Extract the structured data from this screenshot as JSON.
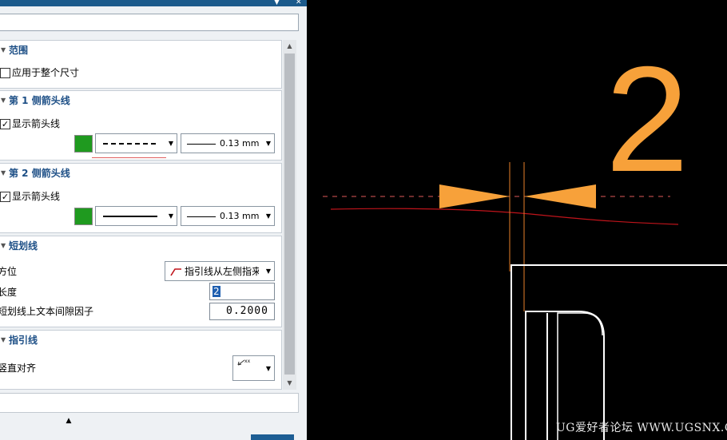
{
  "panel": {
    "groups": {
      "range": {
        "title": "范围",
        "apply_whole_label": "应用于整个尺寸",
        "apply_whole_checked": false
      },
      "arrow1": {
        "title": "第 1 侧箭头线",
        "show_label": "显示箭头线",
        "show_checked": true,
        "color": "#1f9a1f",
        "line_style": "dashed",
        "width_value": "0.13 mm"
      },
      "arrow2": {
        "title": "第 2 侧箭头线",
        "show_label": "显示箭头线",
        "show_checked": true,
        "color": "#1f9a1f",
        "line_style": "solid",
        "width_value": "0.13 mm"
      },
      "stub": {
        "title": "短划线",
        "orientation_label": "方位",
        "orientation_value": "指引线从左侧指来",
        "length_label": "长度",
        "length_value": "2",
        "gap_label": "短划线上文本间隙因子",
        "gap_value": "0.2000"
      },
      "leader": {
        "title": "指引线",
        "align_label": "竖直对齐",
        "align_icon": "text-align-leader-icon",
        "align_icon_text": "xx xxxx xxx"
      }
    },
    "colors": {
      "group_title": "#1d4f86",
      "titlebar": "#1b5a8c",
      "swatch": "#1f9a1f"
    }
  },
  "canvas": {
    "dimension_text": "2",
    "dimension_color": "#f7a13a",
    "arrow_color": "#f7a13a",
    "extension_line_color": "#e87f2a",
    "geometry_color": "#ffffff",
    "curve_color": "#c0141b"
  },
  "watermark": "UG爱好者论坛 WWW.UGSNX.COM"
}
